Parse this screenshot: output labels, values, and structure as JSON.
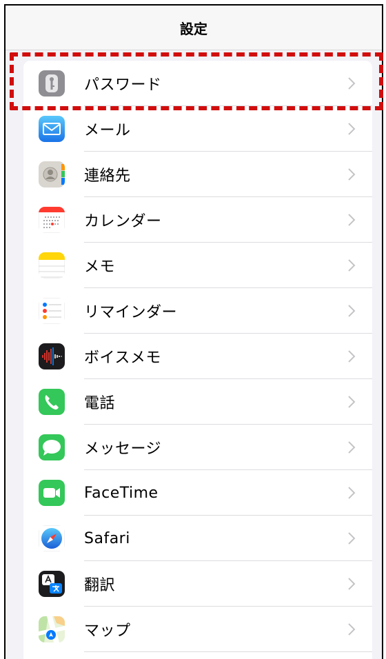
{
  "nav": {
    "title": "設定"
  },
  "items": [
    {
      "label": "パスワード",
      "icon": "key-icon"
    },
    {
      "label": "メール",
      "icon": "mail-icon"
    },
    {
      "label": "連絡先",
      "icon": "contacts-icon"
    },
    {
      "label": "カレンダー",
      "icon": "calendar-icon"
    },
    {
      "label": "メモ",
      "icon": "notes-icon"
    },
    {
      "label": "リマインダー",
      "icon": "reminders-icon"
    },
    {
      "label": "ボイスメモ",
      "icon": "voice-memos-icon"
    },
    {
      "label": "電話",
      "icon": "phone-icon"
    },
    {
      "label": "メッセージ",
      "icon": "messages-icon"
    },
    {
      "label": "FaceTime",
      "icon": "facetime-icon"
    },
    {
      "label": "Safari",
      "icon": "safari-icon"
    },
    {
      "label": "翻訳",
      "icon": "translate-icon"
    },
    {
      "label": "マップ",
      "icon": "maps-icon"
    }
  ],
  "colors": {
    "highlight": "#d10d0d",
    "chevron": "#c4c4c7",
    "background": "#f2f2f7"
  }
}
